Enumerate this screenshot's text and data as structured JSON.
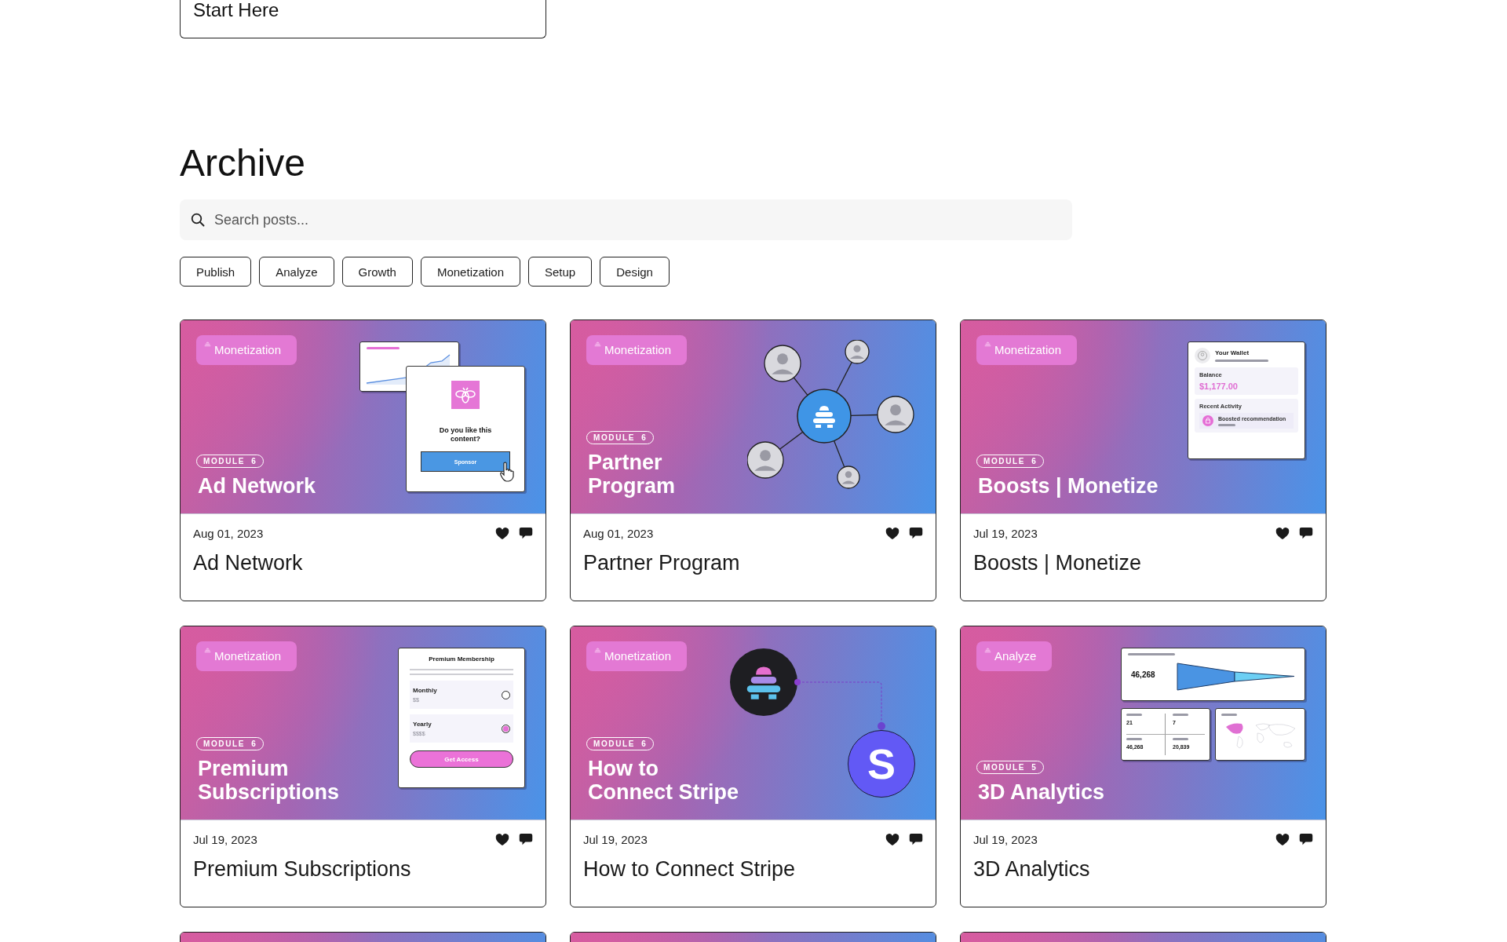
{
  "start_here": {
    "title": "Start Here"
  },
  "archive": {
    "heading": "Archive",
    "search": {
      "placeholder": "Search posts..."
    },
    "filters": [
      {
        "label": "Publish",
        "selected": false
      },
      {
        "label": "Analyze",
        "selected": false
      },
      {
        "label": "Growth",
        "selected": false
      },
      {
        "label": "Monetization",
        "selected": false
      },
      {
        "label": "Setup",
        "selected": false
      },
      {
        "label": "Design",
        "selected": false
      }
    ],
    "posts": [
      {
        "kind": "full",
        "tag": "Monetization",
        "module": "MODULE 6",
        "image_title": "Ad Network",
        "illustration": {
          "kind": "ad",
          "question": "Do you like this content?",
          "button": "Sponsor"
        },
        "date": "Aug 01, 2023",
        "title": "Ad Network"
      },
      {
        "kind": "full",
        "tag": "Monetization",
        "module": "MODULE 6",
        "image_title": "Partner\nProgram",
        "illustration": {
          "kind": "network"
        },
        "date": "Aug 01, 2023",
        "title": "Partner Program"
      },
      {
        "kind": "full",
        "tag": "Monetization",
        "module": "MODULE 6",
        "image_title": "Boosts | Monetize",
        "illustration": {
          "kind": "wallet",
          "heading": "Your Wallet",
          "balance_label": "Balance",
          "balance": "$1,177.00",
          "activity_label": "Recent Activity",
          "activity_item": "Boosted recommendation"
        },
        "date": "Jul 19, 2023",
        "title": "Boosts | Monetize"
      },
      {
        "kind": "full",
        "tag": "Monetization",
        "module": "MODULE 6",
        "image_title": "Premium\nSubscriptions",
        "illustration": {
          "kind": "membership",
          "heading": "Premium Membership",
          "options": [
            {
              "label": "Monthly",
              "price": "$$",
              "selected": false
            },
            {
              "label": "Yearly",
              "price": "$$$$",
              "selected": true
            }
          ],
          "button": "Get Access"
        },
        "date": "Jul 19, 2023",
        "title": "Premium Subscriptions"
      },
      {
        "kind": "full",
        "tag": "Monetization",
        "module": "MODULE 6",
        "image_title": "How to\nConnect Stripe",
        "illustration": {
          "kind": "connect",
          "logo_letter": "S"
        },
        "date": "Jul 19, 2023",
        "title": "How to Connect Stripe"
      },
      {
        "kind": "full",
        "tag": "Analyze",
        "module": "MODULE 5",
        "image_title": "3D Analytics",
        "illustration": {
          "kind": "analytics",
          "total": "46,268",
          "stats": [
            "21",
            "7",
            "46,268",
            "20,839"
          ]
        },
        "date": "Jul 19, 2023",
        "title": "3D Analytics"
      },
      {
        "kind": "partial"
      },
      {
        "kind": "partial"
      },
      {
        "kind": "partial"
      }
    ]
  }
}
